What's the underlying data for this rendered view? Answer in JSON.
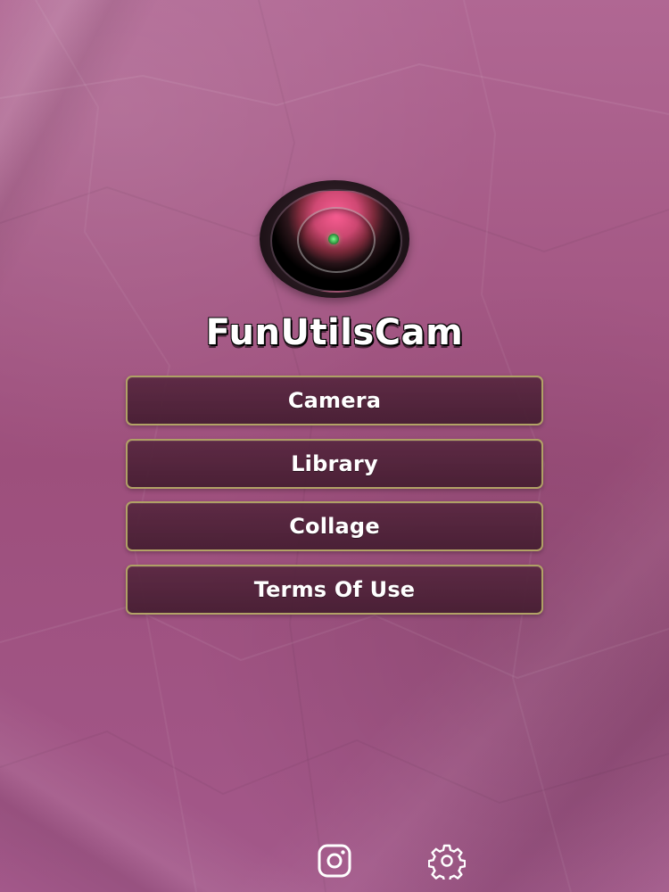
{
  "app": {
    "title": "FunUtilsCam"
  },
  "menu": {
    "items": [
      {
        "label": "Camera"
      },
      {
        "label": "Library"
      },
      {
        "label": "Collage"
      },
      {
        "label": "Terms Of Use"
      }
    ]
  },
  "icons": {
    "logo": "camera-lens-icon",
    "bottom_left": "instagram-icon",
    "bottom_right": "gear-icon"
  },
  "colors": {
    "background": "#a55a87",
    "button_fill": "#4b2136",
    "button_border": "#c1b76d",
    "text": "#ffffff"
  }
}
